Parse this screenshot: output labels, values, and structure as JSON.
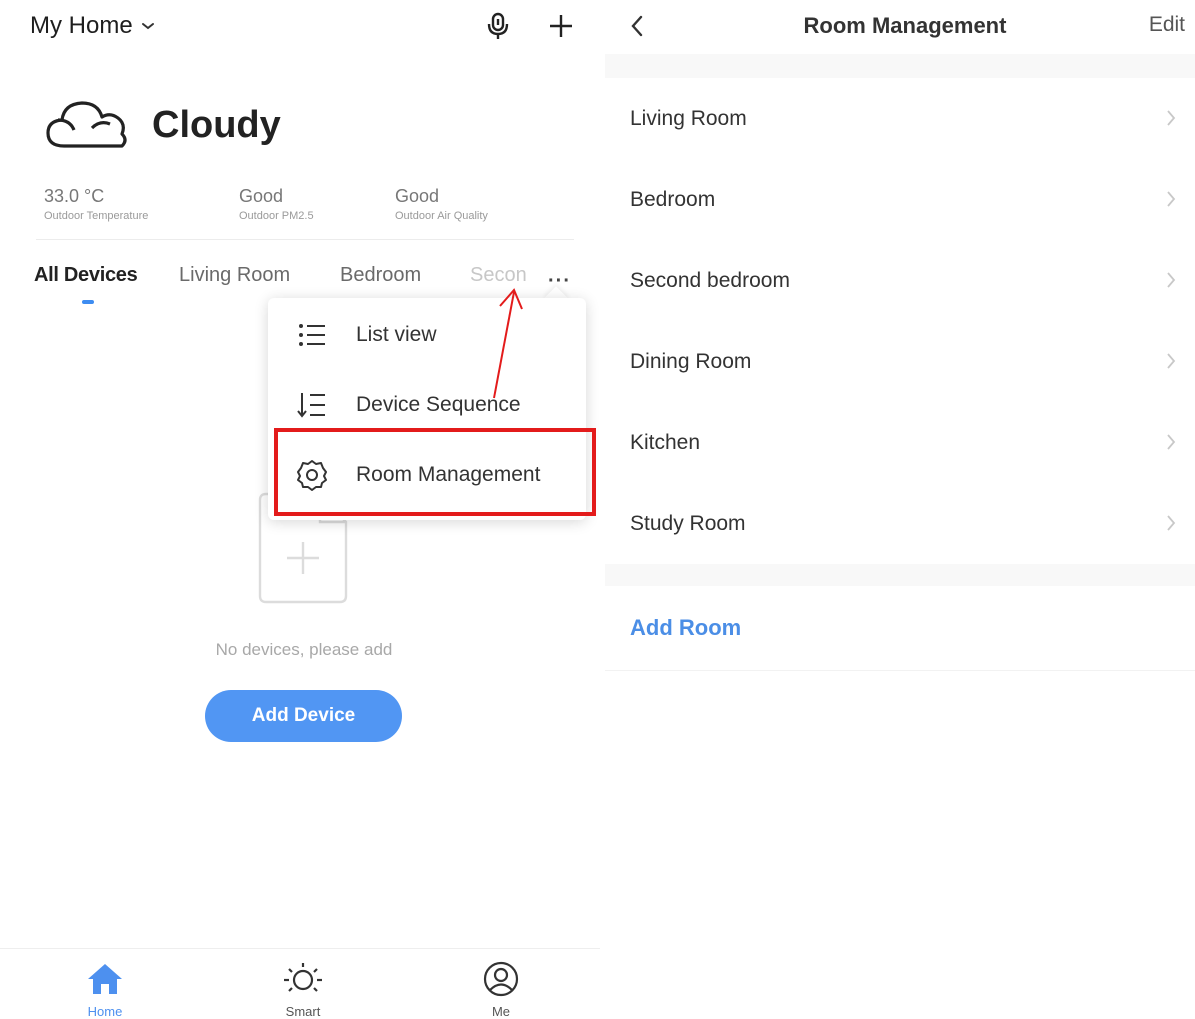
{
  "left": {
    "header": {
      "home_label": "My Home",
      "icons": [
        "microphone-icon",
        "plus-icon"
      ]
    },
    "weather": {
      "icon": "cloud-icon",
      "title": "Cloudy",
      "stats": [
        {
          "value": "33.0 °C",
          "label": "Outdoor Temperature"
        },
        {
          "value": "Good",
          "label": "Outdoor PM2.5"
        },
        {
          "value": "Good",
          "label": "Outdoor Air Quality"
        }
      ]
    },
    "tabs": [
      "All Devices",
      "Living Room",
      "Bedroom",
      "Secon"
    ],
    "more_label": "···",
    "menu": [
      {
        "label": "List view",
        "icon": "list-icon"
      },
      {
        "label": "Device Sequence",
        "icon": "sort-icon"
      },
      {
        "label": "Room Management",
        "icon": "gear-icon"
      }
    ],
    "empty_text": "No devices, please add",
    "add_device_label": "Add Device",
    "bottom_nav": [
      {
        "label": "Home",
        "icon": "home-icon"
      },
      {
        "label": "Smart",
        "icon": "sun-icon"
      },
      {
        "label": "Me",
        "icon": "user-icon"
      }
    ],
    "accent_color": "#4d90ef",
    "highlight_color": "#e31b1b"
  },
  "right": {
    "title": "Room Management",
    "edit_label": "Edit",
    "rooms": [
      "Living Room",
      "Bedroom",
      "Second bedroom",
      "Dining Room",
      "Kitchen",
      "Study Room"
    ],
    "add_room_label": "Add Room"
  }
}
